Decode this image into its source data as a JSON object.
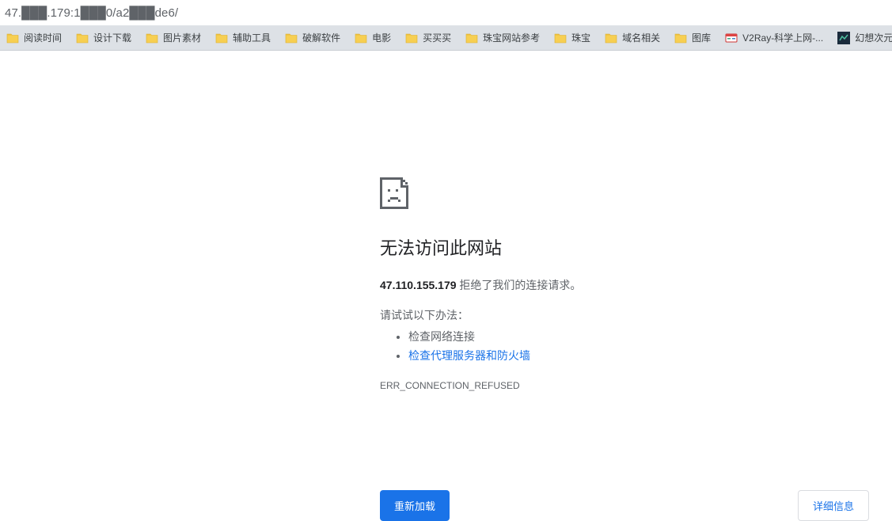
{
  "address_bar": {
    "url": "47.███.179:1███0/a2███de6/"
  },
  "bookmarks": [
    {
      "label": "阅读时间",
      "icon": "folder"
    },
    {
      "label": "设计下载",
      "icon": "folder"
    },
    {
      "label": "图片素材",
      "icon": "folder"
    },
    {
      "label": "辅助工具",
      "icon": "folder"
    },
    {
      "label": "破解软件",
      "icon": "folder"
    },
    {
      "label": "电影",
      "icon": "folder"
    },
    {
      "label": "买买买",
      "icon": "folder"
    },
    {
      "label": "珠宝网站参考",
      "icon": "folder"
    },
    {
      "label": "珠宝",
      "icon": "folder"
    },
    {
      "label": "域名相关",
      "icon": "folder"
    },
    {
      "label": "图库",
      "icon": "folder"
    },
    {
      "label": "V2Ray-科学上网-...",
      "icon": "v2ray"
    },
    {
      "label": "幻想次元 | 漫",
      "icon": "dark"
    }
  ],
  "error": {
    "title": "无法访问此网站",
    "host": "47.110.155.179",
    "message_suffix": " 拒绝了我们的连接请求。",
    "suggestions_label": "请试试以下办法：",
    "suggestions": [
      {
        "text": "检查网络连接",
        "link": false
      },
      {
        "text": "检查代理服务器和防火墙",
        "link": true
      }
    ],
    "code": "ERR_CONNECTION_REFUSED",
    "reload_label": "重新加载",
    "details_label": "详细信息"
  }
}
